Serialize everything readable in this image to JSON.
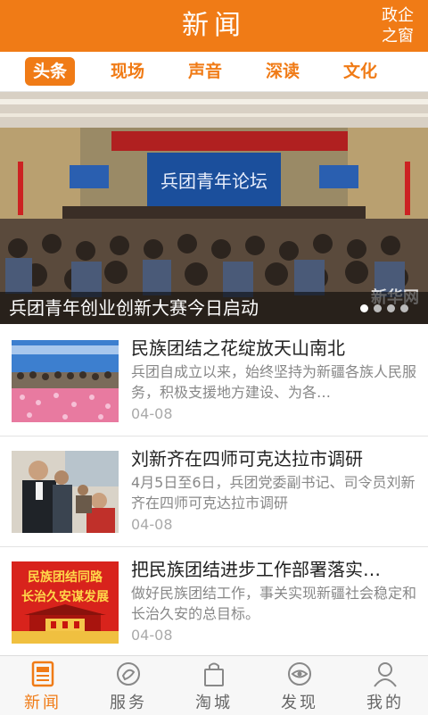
{
  "header": {
    "title": "新闻",
    "corner_link": "政企之窗"
  },
  "tabs": [
    {
      "label": "头条",
      "active": true
    },
    {
      "label": "现场",
      "active": false
    },
    {
      "label": "声音",
      "active": false
    },
    {
      "label": "深读",
      "active": false
    },
    {
      "label": "文化",
      "active": false
    }
  ],
  "banner": {
    "caption": "兵团青年创业创新大赛今日启动",
    "stage_banner_text": "兵团青年论坛",
    "watermark": "新华网",
    "slide_count": 4,
    "active_slide": 1
  },
  "news": [
    {
      "title": "民族团结之花绽放天山南北",
      "summary": "兵团自成立以来，始终坚持为新疆各族人民服务，积极支援地方建设、为各…",
      "date": "04-08"
    },
    {
      "title": "刘新齐在四师可克达拉市调研",
      "summary": "4月5日至6日，兵团党委副书记、司令员刘新齐在四师可克达拉市调研",
      "date": "04-08"
    },
    {
      "title": "把民族团结进步工作部署落实…",
      "summary": "做好民族团结工作，事关实现新疆社会稳定和长治久安的总目标。",
      "date": "04-08",
      "thumb_text_1": "民族团结同路",
      "thumb_text_2": "长治久安谋发展"
    }
  ],
  "bottom_nav": [
    {
      "label": "新闻",
      "icon": "newspaper-icon",
      "active": true
    },
    {
      "label": "服务",
      "icon": "service-icon",
      "active": false
    },
    {
      "label": "淘城",
      "icon": "shopping-bag-icon",
      "active": false
    },
    {
      "label": "发现",
      "icon": "discover-eye-icon",
      "active": false
    },
    {
      "label": "我的",
      "icon": "user-icon",
      "active": false
    }
  ],
  "colors": {
    "accent": "#f07b16",
    "text": "#222222",
    "muted": "#888888"
  }
}
